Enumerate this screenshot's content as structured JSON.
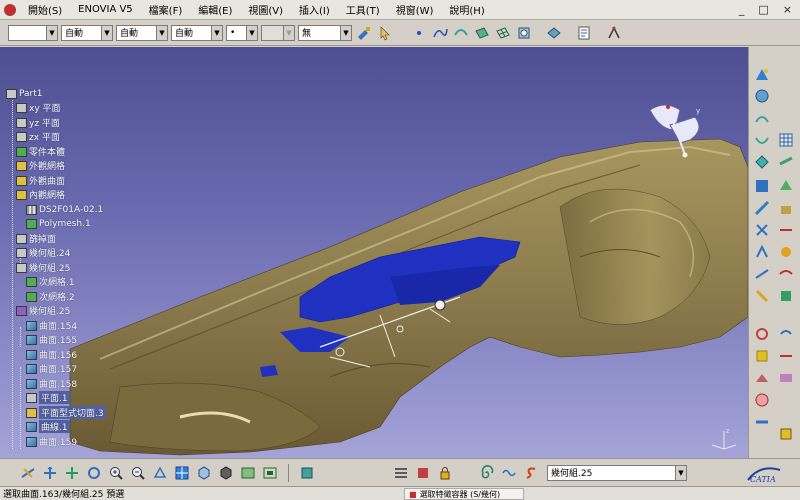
{
  "menubar": {
    "items": [
      "開始(S)",
      "ENOVIA V5",
      "檔案(F)",
      "編輯(E)",
      "視圖(V)",
      "插入(I)",
      "工具(T)",
      "視窗(W)",
      "說明(H)"
    ],
    "controls": [
      "_",
      "□",
      "×"
    ]
  },
  "toolbar": {
    "combos": [
      "",
      "自動",
      "自動",
      "自動",
      "•",
      "",
      "無"
    ]
  },
  "tree": [
    {
      "label": "Part1",
      "icon": "part"
    },
    {
      "label": "xy 平面",
      "icon": "plane"
    },
    {
      "label": "yz 平面",
      "icon": "plane"
    },
    {
      "label": "zx 平面",
      "icon": "plane"
    },
    {
      "label": "零件本體",
      "icon": "body"
    },
    {
      "label": "外觀網格",
      "icon": "mesh"
    },
    {
      "label": "外觀曲面",
      "icon": "mesh"
    },
    {
      "label": "內觀網格",
      "icon": "mesh"
    },
    {
      "label": "DS2F01A-02.1",
      "icon": "cloud"
    },
    {
      "label": "Polymesh.1",
      "icon": "polymesh"
    },
    {
      "label": "篩掉面",
      "icon": "set"
    },
    {
      "label": "幾何組.24",
      "icon": "set"
    },
    {
      "label": "幾何組.25",
      "icon": "set"
    },
    {
      "label": "次網格.1",
      "icon": "submesh"
    },
    {
      "label": "次網格.2",
      "icon": "submesh"
    },
    {
      "label": "幾何組.25",
      "icon": "set"
    },
    {
      "label": "曲面.154",
      "icon": "surface"
    },
    {
      "label": "曲面.155",
      "icon": "surface"
    },
    {
      "label": "曲面.156",
      "icon": "surface"
    },
    {
      "label": "曲面.157",
      "icon": "surface"
    },
    {
      "label": "曲面.158",
      "icon": "surface"
    },
    {
      "label": "平面.1",
      "icon": "plane2"
    },
    {
      "label": "平面型式切面.3",
      "icon": "plane2"
    },
    {
      "label": "曲線.1",
      "icon": "surface"
    },
    {
      "label": "曲面.159",
      "icon": "surface"
    }
  ],
  "bottom": {
    "combo_value": "幾何組.25"
  },
  "status": {
    "text": "選取曲面.163/幾何組.25 預選",
    "popup": "選取特徵容器 (S/幾何)"
  },
  "logo": "CATIA",
  "colors": {
    "model": "#8b7a4c",
    "highlight": "#2030c0",
    "bg_top": "#4e4e92",
    "bg_bottom": "#a4a4d8"
  }
}
